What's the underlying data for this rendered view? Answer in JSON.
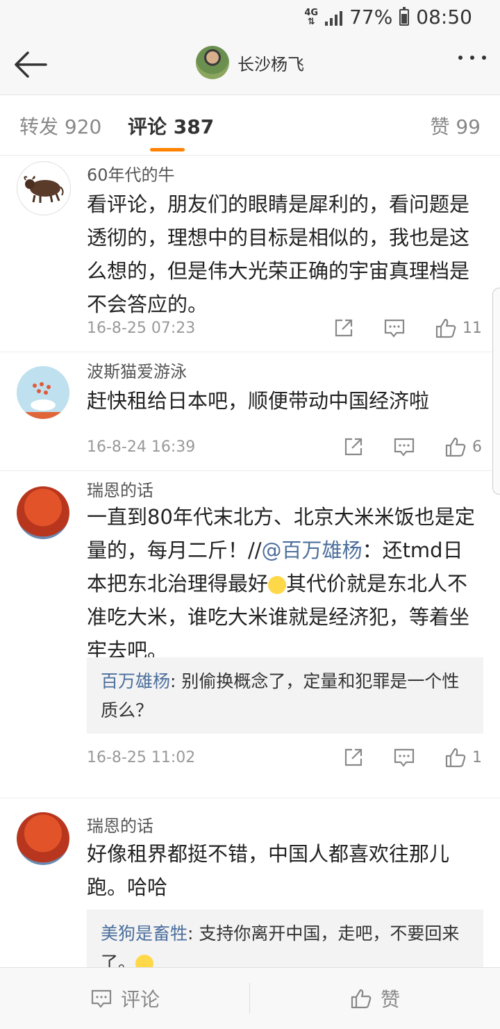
{
  "status": {
    "network": "4G",
    "battery": "77%",
    "battery_level": 0.77,
    "time": "08:50"
  },
  "header": {
    "title": "长沙杨飞"
  },
  "tabs": {
    "repost": "转发 920",
    "comment": "评论 387",
    "like": "赞 99"
  },
  "comments": [
    {
      "name": "60年代的牛",
      "text": "看评论，朋友们的眼睛是犀利的，看问题是透彻的，理想中的目标是相似的，我也是这么想的，但是伟大光荣正确的宇宙真理档是不会答应的。",
      "time": "16-8-25 07:23",
      "likes": "11"
    },
    {
      "name": "波斯猫爱游泳",
      "text": "赶快租给日本吧，顺便带动中国经济啦",
      "time": "16-8-24 16:39",
      "likes": "6"
    },
    {
      "name": "瑞恩的话",
      "text_a": "一直到80年代末北方、北京大米米饭也是定量的，每月二斤！//",
      "mention": "@百万雄杨",
      "text_b": "：还tmd日本把东北治理得最好",
      "text_c": "其代价就是东北人不准吃大米，谁吃大米谁就是经济犯，等着坐牢去吧。",
      "reply_name": "百万雄杨",
      "reply_text": ": 别偷换概念了，定量和犯罪是一个性质么？",
      "time": "16-8-25 11:02",
      "likes": "1"
    },
    {
      "name": "瑞恩的话",
      "text": "好像租界都挺不错，中国人都喜欢往那儿跑。哈哈",
      "reply_name": "美狗是畜牲",
      "reply_text": ": 支持你离开中国，走吧，不要回来了。"
    }
  ],
  "bottom": {
    "comment": "评论",
    "like": "赞"
  },
  "colors": {
    "accent": "#ff8200",
    "link": "#4d6f9d"
  },
  "icons": [
    "back-arrow-icon",
    "more-icon",
    "share-icon",
    "comment-icon",
    "thumb-up-icon"
  ]
}
